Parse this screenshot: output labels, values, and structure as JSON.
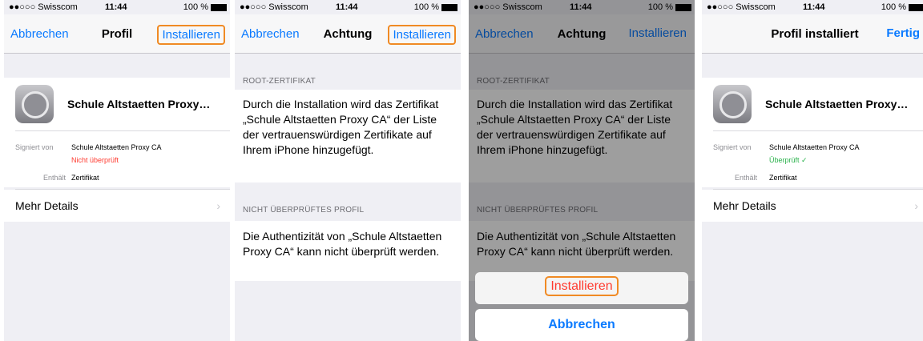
{
  "status": {
    "carrier": "●●○○○ Swisscom",
    "wifi": "wifi-icon",
    "time": "11:44",
    "battery": "100 %"
  },
  "screen1": {
    "nav_left": "Abbrechen",
    "nav_title": "Profil",
    "nav_right": "Installieren",
    "profile_name": "Schule Altstaetten Proxy…",
    "signed_label": "Signiert von",
    "signed_value": "Schule Altstaetten Proxy CA",
    "verify_status": "Nicht überprüft",
    "contains_label": "Enthält",
    "contains_value": "Zertifikat",
    "more_details": "Mehr Details"
  },
  "screen2": {
    "nav_left": "Abbrechen",
    "nav_title": "Achtung",
    "nav_right": "Installieren",
    "section1_header": "ROOT-ZERTIFIKAT",
    "section1_text": "Durch die Installation wird das Zertifikat „Schule Altstaetten Proxy CA“ der Liste der vertrauenswürdigen Zertifikate auf Ihrem iPhone hinzugefügt.",
    "section2_header": "NICHT ÜBERPRÜFTES PROFIL",
    "section2_text": "Die Authentizität von „Schule Altstaetten Proxy CA“ kann nicht überprüft werden."
  },
  "screen3": {
    "nav_left": "Abbrechen",
    "nav_title": "Achtung",
    "nav_right": "Installieren",
    "section1_header": "ROOT-ZERTIFIKAT",
    "section1_text": "Durch die Installation wird das Zertifikat „Schule Altstaetten Proxy CA“ der Liste der vertrauenswürdigen Zertifikate auf Ihrem iPhone hinzugefügt.",
    "section2_header": "NICHT ÜBERPRÜFTES PROFIL",
    "section2_text": "Die Authentizität von „Schule Altstaetten Proxy CA“ kann nicht überprüft werden.",
    "sheet_install": "Installieren",
    "sheet_cancel": "Abbrechen"
  },
  "screen4": {
    "nav_title": "Profil installiert",
    "nav_right": "Fertig",
    "profile_name": "Schule Altstaetten Proxy…",
    "signed_label": "Signiert von",
    "signed_value": "Schule Altstaetten Proxy CA",
    "verify_status": "Überprüft ✓",
    "contains_label": "Enthält",
    "contains_value": "Zertifikat",
    "more_details": "Mehr Details"
  },
  "colors": {
    "ios_blue": "#0a7aff",
    "red": "#ff3b30",
    "green": "#2bb24c",
    "highlight": "#f08a24"
  }
}
